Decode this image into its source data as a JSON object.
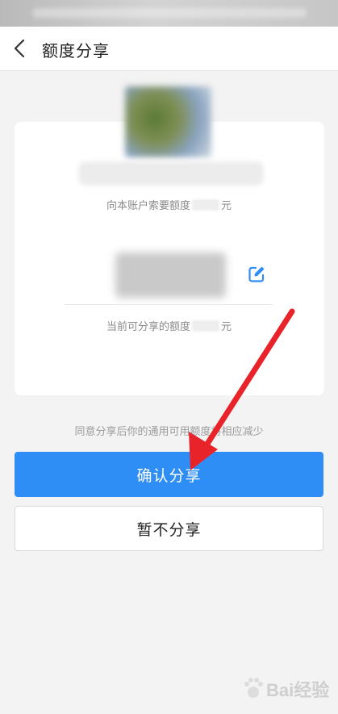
{
  "nav": {
    "title": "额度分享",
    "back_icon": "chevron-left-icon"
  },
  "card": {
    "request_prefix": "向本账户索要额度",
    "request_suffix": "元",
    "available_prefix": "当前可分享的额度",
    "available_suffix": "元",
    "edit_icon": "edit-icon"
  },
  "notice": "同意分享后你的通用可用额度将相应减少",
  "buttons": {
    "confirm": "确认分享",
    "decline": "暂不分享"
  },
  "watermark": {
    "text": "Bai经验"
  },
  "colors": {
    "primary": "#2f8ef5",
    "arrow": "#e8232a",
    "background": "#f3f3f3"
  }
}
